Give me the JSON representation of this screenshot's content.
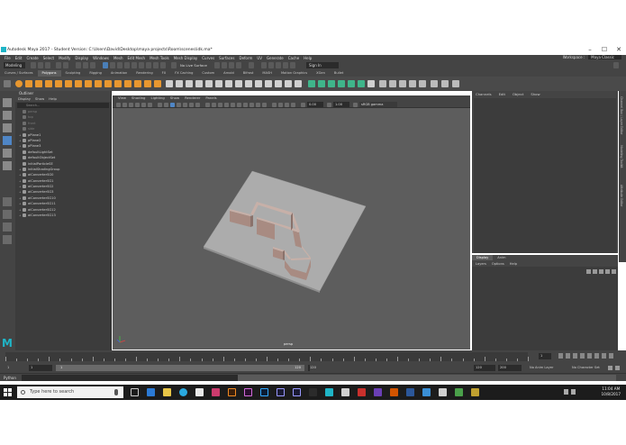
{
  "window": {
    "title": "Autodesk Maya 2017 - Student Version: C:\\Users\\David\\Desktop\\maya projects\\Room\\scenes\\idk.ma*"
  },
  "menubar": {
    "items": [
      "File",
      "Edit",
      "Create",
      "Select",
      "Modify",
      "Display",
      "Windows",
      "Mesh",
      "Edit Mesh",
      "Mesh Tools",
      "Mesh Display",
      "Curves",
      "Surfaces",
      "Deform",
      "UV",
      "Generate",
      "Cache",
      "Help"
    ],
    "workspace_label": "Workspace :",
    "workspace_value": "Maya Classic"
  },
  "statusline": {
    "mode": "Modeling",
    "no_live_surface": "No Live Surface",
    "sign_in": "Sign In"
  },
  "shelf": {
    "tabs": [
      "Curves / Surfaces",
      "Polygons",
      "Sculpting",
      "Rigging",
      "Animation",
      "Rendering",
      "FX",
      "FX Caching",
      "Custom",
      "Arnold",
      "Bifrost",
      "MASH",
      "Motion Graphics",
      "XGen",
      "Bullet"
    ],
    "active_tab": "Polygons"
  },
  "outliner": {
    "title": "Outliner",
    "menu": [
      "Display",
      "Show",
      "Help"
    ],
    "search_placeholder": "Search...",
    "items": [
      {
        "label": "persp",
        "dim": true,
        "expand": ""
      },
      {
        "label": "top",
        "dim": true,
        "expand": ""
      },
      {
        "label": "front",
        "dim": true,
        "expand": ""
      },
      {
        "label": "side",
        "dim": true,
        "expand": ""
      },
      {
        "label": "pPlane1",
        "dim": false,
        "expand": "+"
      },
      {
        "label": "pPlane2",
        "dim": false,
        "expand": "+"
      },
      {
        "label": "pPlane3",
        "dim": false,
        "expand": "+"
      },
      {
        "label": "defaultLightSet",
        "dim": false,
        "expand": ""
      },
      {
        "label": "defaultObjectSet",
        "dim": false,
        "expand": ""
      },
      {
        "label": "initialParticleSE",
        "dim": false,
        "expand": ""
      },
      {
        "label": "initialShadingGroup",
        "dim": false,
        "expand": "+"
      },
      {
        "label": "aiConverterSG0",
        "dim": false,
        "expand": "+"
      },
      {
        "label": "aiConverterSG1",
        "dim": false,
        "expand": "+"
      },
      {
        "label": "aiConverterSG2",
        "dim": false,
        "expand": "+"
      },
      {
        "label": "aiConverterSG3",
        "dim": false,
        "expand": "+"
      },
      {
        "label": "aiConverterSG10",
        "dim": false,
        "expand": "+"
      },
      {
        "label": "aiConverterSG11",
        "dim": false,
        "expand": "+"
      },
      {
        "label": "aiConverterSG12",
        "dim": false,
        "expand": "+"
      },
      {
        "label": "aiConverterSG13",
        "dim": false,
        "expand": "+"
      }
    ]
  },
  "viewport": {
    "menu": [
      "View",
      "Shading",
      "Lighting",
      "Show",
      "Renderer",
      "Panels"
    ],
    "value_a": "0.00",
    "value_b": "1.00",
    "colorspace": "sRGB gamma",
    "camera_label": "persp"
  },
  "channelbox": {
    "menu": [
      "Channels",
      "Edit",
      "Object",
      "Show"
    ]
  },
  "side_tabs": [
    "Channel Box / Layer Editor",
    "Modeling Toolkit",
    "Attribute Editor"
  ],
  "layer_editor": {
    "tabs": [
      "Display",
      "Anim"
    ],
    "active_tab": "Display",
    "menu": [
      "Layers",
      "Options",
      "Help"
    ]
  },
  "timeslider": {
    "current_frame": "1"
  },
  "range": {
    "start": "1",
    "playback_start": "1",
    "playback_end": "120",
    "handle_start": "1",
    "handle_end": "120",
    "end_a": "120",
    "end_b": "200",
    "anim_layer": "No Anim Layer",
    "character_set": "No Character Set"
  },
  "cmdline": {
    "label": "Python"
  },
  "taskbar": {
    "search_placeholder": "Type here to search",
    "time": "11:04 AM",
    "date": "10/8/2017"
  },
  "colors": {
    "viewport_bg": "#5d5d5d",
    "plane": "#aaaaaa",
    "wall": "#b89b91",
    "maya_accent": "#1fb5c7"
  }
}
